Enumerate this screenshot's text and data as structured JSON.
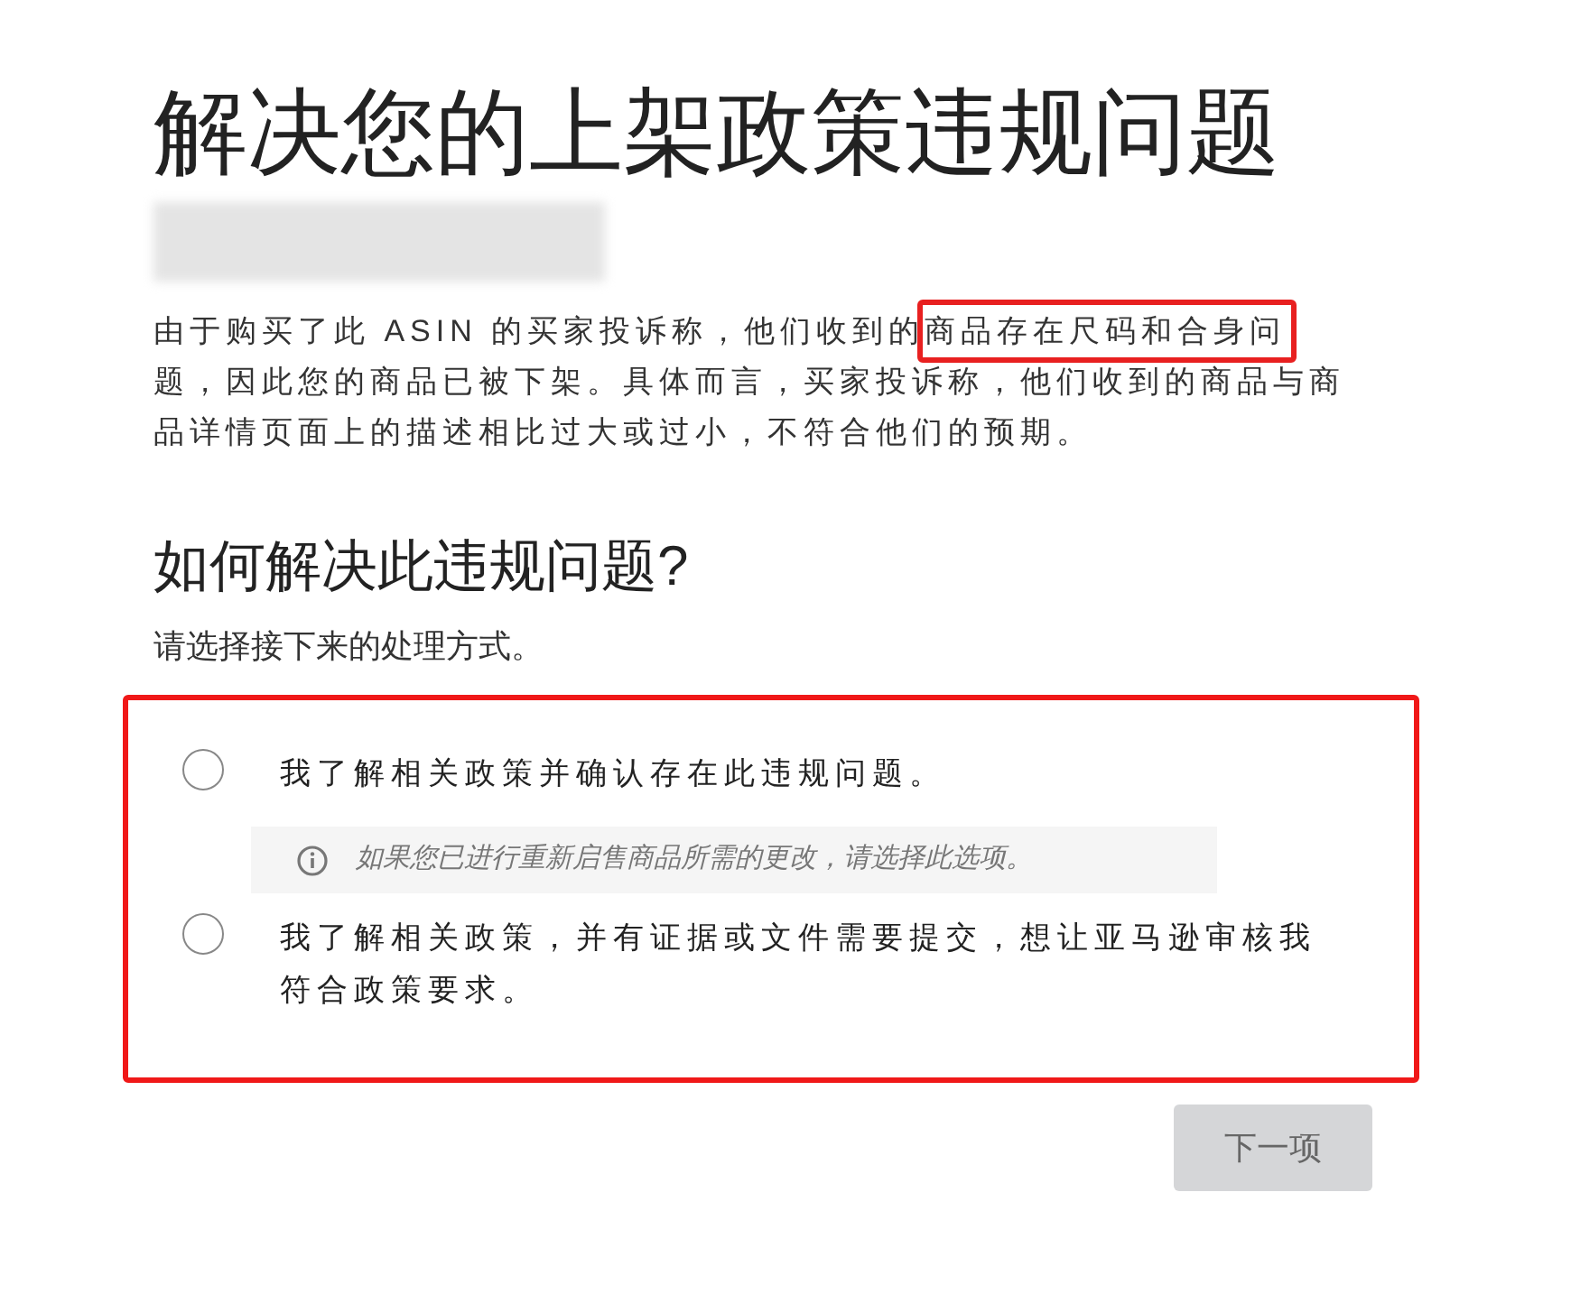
{
  "title": "解决您的上架政策违规问题",
  "description": {
    "before": "由于购买了此 ASIN 的买家投诉称，他们收到的",
    "highlighted": "商品存在尺码和合身问",
    "after": "题，因此您的商品已被下架。具体而言，买家投诉称，他们收到的商品与商品详情页面上的描述相比过大或过小，不符合他们的预期。"
  },
  "question": {
    "heading": "如何解决此违规问题?",
    "subtitle": "请选择接下来的处理方式。"
  },
  "options": [
    {
      "label": "我了解相关政策并确认存在此违规问题。",
      "selected": false,
      "hint": "如果您已进行重新启售商品所需的更改，请选择此选项。"
    },
    {
      "label": "我了解相关政策，并有证据或文件需要提交，想让亚马逊审核我符合政策要求。",
      "selected": false
    }
  ],
  "next_button": {
    "label": "下一项",
    "disabled": true
  }
}
